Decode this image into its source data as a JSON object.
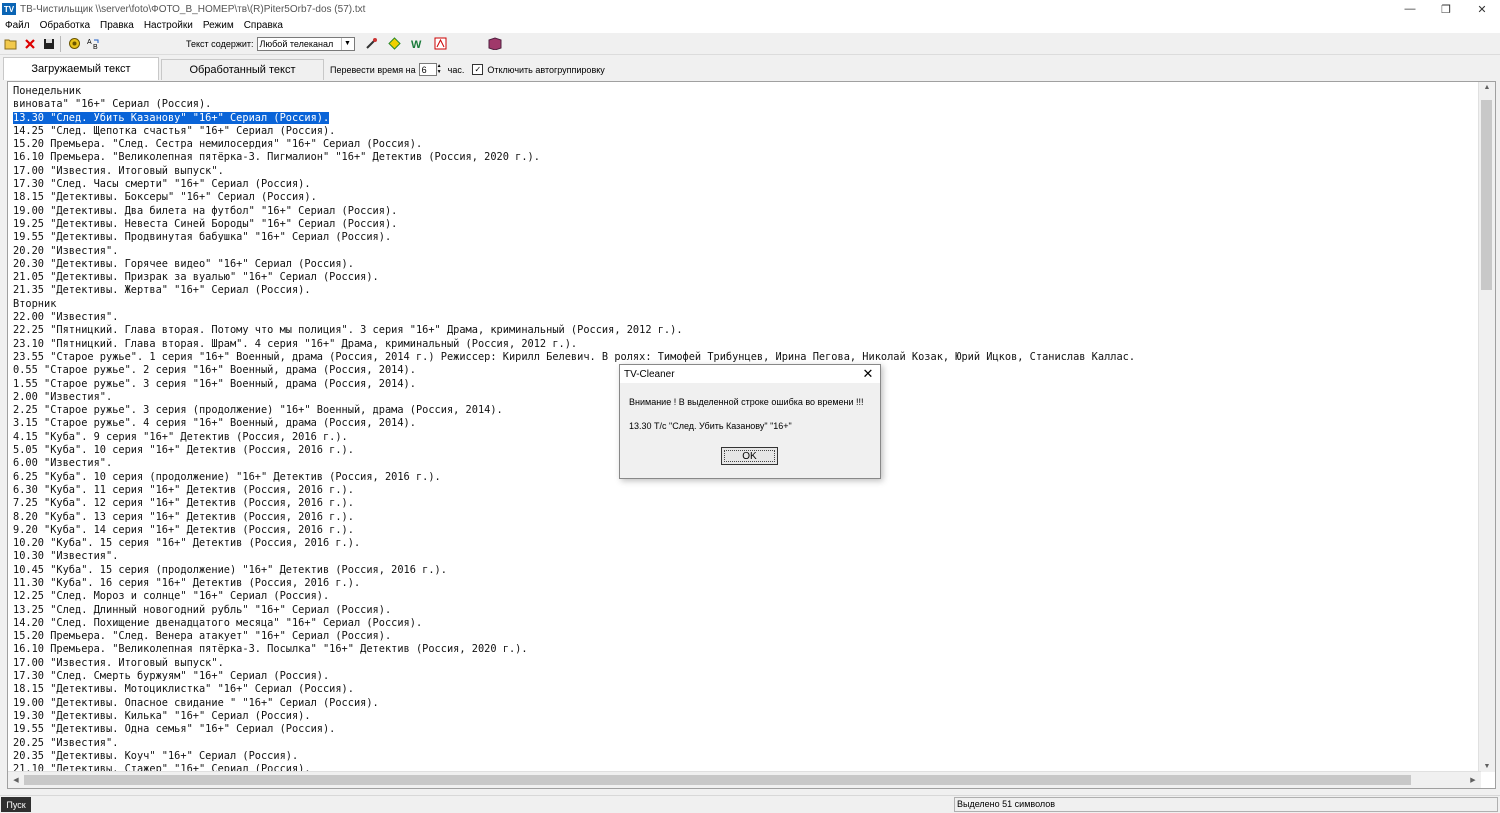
{
  "window": {
    "app_icon": "TV",
    "title": "ТВ-Чистильщик    \\\\server\\foto\\ФОТО_В_НОМЕР\\тв\\(R)Piter5Orb7-dos (57).txt",
    "minimize_glyph": "—",
    "maximize_glyph": "❐",
    "close_glyph": "✕"
  },
  "menu": [
    "Файл",
    "Обработка",
    "Правка",
    "Настройки",
    "Режим",
    "Справка"
  ],
  "toolbar": {
    "icons": [
      "folder-open-icon",
      "delete-icon",
      "save-icon",
      "process-icon",
      "replace-icon"
    ],
    "filter_label": "Текст содержит:",
    "filter_value": "Любой телеканал",
    "right_icons": [
      "tools-icon",
      "diamond-icon",
      "w-icon",
      "acrobat-icon",
      "book-icon"
    ]
  },
  "tabs": {
    "loaded": "Загружаемый текст",
    "processed": "Обработанный текст",
    "shift_label": "Перевести время на",
    "shift_value": "6",
    "shift_unit": "час.",
    "autogroup_label": "Отключить автогруппировку",
    "autogroup_checked": true
  },
  "text_lines": [
    "Понедельник",
    "виновата\" \"16+\" Сериал (Россия).",
    "13.30 \"След. Убить Казанову\" \"16+\" Сериал (Россия).",
    "14.25 \"След. Щепотка счастья\" \"16+\" Сериал (Россия).",
    "15.20 Премьера. \"След. Сестра немилосердия\" \"16+\" Сериал (Россия).",
    "16.10 Премьера. \"Великолепная пятёрка-3. Пигмалион\" \"16+\" Детектив (Россия, 2020 г.).",
    "17.00 \"Известия. Итоговый выпуск\".",
    "17.30 \"След. Часы смерти\" \"16+\" Сериал (Россия).",
    "18.15 \"Детективы. Боксеры\" \"16+\" Сериал (Россия).",
    "19.00 \"Детективы. Два билета на футбол\" \"16+\" Сериал (Россия).",
    "19.25 \"Детективы. Невеста Синей Бороды\" \"16+\" Сериал (Россия).",
    "19.55 \"Детективы. Продвинутая бабушка\" \"16+\" Сериал (Россия).",
    "20.20 \"Известия\".",
    "20.30 \"Детективы. Горячее видео\" \"16+\" Сериал (Россия).",
    "21.05 \"Детективы. Призрак за вуалью\" \"16+\" Сериал (Россия).",
    "21.35 \"Детективы. Жертва\" \"16+\" Сериал (Россия).",
    "Вторник",
    "22.00 \"Известия\".",
    "22.25 \"Пятницкий. Глава вторая. Потому что мы полиция\". 3 серия \"16+\" Драма, криминальный (Россия, 2012 г.).",
    "23.10 \"Пятницкий. Глава вторая. Шрам\". 4 серия \"16+\" Драма, криминальный (Россия, 2012 г.).",
    "23.55 \"Старое ружье\". 1 серия \"16+\" Военный, драма (Россия, 2014 г.) Режиссер: Кирилл Белевич. В ролях: Тимофей Трибунцев, Ирина Пегова, Николай Козак, Юрий Ицков, Станислав Каллас.",
    "0.55 \"Старое ружье\". 2 серия \"16+\" Военный, драма (Россия, 2014).",
    "1.55 \"Старое ружье\". 3 серия \"16+\" Военный, драма (Россия, 2014).",
    "2.00 \"Известия\".",
    "2.25 \"Старое ружье\". 3 серия (продолжение) \"16+\" Военный, драма (Россия, 2014).",
    "3.15 \"Старое ружье\". 4 серия \"16+\" Военный, драма (Россия, 2014).",
    "4.15 \"Куба\". 9 серия \"16+\" Детектив (Россия, 2016 г.).",
    "5.05 \"Куба\". 10 серия \"16+\" Детектив (Россия, 2016 г.).",
    "6.00 \"Известия\".",
    "6.25 \"Куба\". 10 серия (продолжение) \"16+\" Детектив (Россия, 2016 г.).",
    "6.30 \"Куба\". 11 серия \"16+\" Детектив (Россия, 2016 г.).",
    "7.25 \"Куба\". 12 серия \"16+\" Детектив (Россия, 2016 г.).",
    "8.20 \"Куба\". 13 серия \"16+\" Детектив (Россия, 2016 г.).",
    "9.20 \"Куба\". 14 серия \"16+\" Детектив (Россия, 2016 г.).",
    "10.20 \"Куба\". 15 серия \"16+\" Детектив (Россия, 2016 г.).",
    "10.30 \"Известия\".",
    "10.45 \"Куба\". 15 серия (продолжение) \"16+\" Детектив (Россия, 2016 г.).",
    "11.30 \"Куба\". 16 серия \"16+\" Детектив (Россия, 2016 г.).",
    "12.25 \"След. Мороз и солнце\" \"16+\" Сериал (Россия).",
    "13.25 \"След. Длинный новогодний рубль\" \"16+\" Сериал (Россия).",
    "14.20 \"След. Похищение двенадцатого месяца\" \"16+\" Сериал (Россия).",
    "15.20 Премьера. \"След. Венера атакует\" \"16+\" Сериал (Россия).",
    "16.10 Премьера. \"Великолепная пятёрка-3. Посылка\" \"16+\" Детектив (Россия, 2020 г.).",
    "17.00 \"Известия. Итоговый выпуск\".",
    "17.30 \"След. Смерть буржуям\" \"16+\" Сериал (Россия).",
    "18.15 \"Детективы. Мотоциклистка\" \"16+\" Сериал (Россия).",
    "19.00 \"Детективы. Опасное свидание \" \"16+\" Сериал (Россия).",
    "19.30 \"Детективы. Килька\" \"16+\" Сериал (Россия).",
    "19.55 \"Детективы. Одна семья\" \"16+\" Сериал (Россия).",
    "20.25 \"Известия\".",
    "20.35 \"Детективы. Коуч\" \"16+\" Сериал (Россия).",
    "21.10 \"Детективы. Стажер\" \"16+\" Сериал (Россия)."
  ],
  "selected_line_index": 2,
  "dialog": {
    "title": "TV-Cleaner",
    "message": "Внимание ! В выделенной строке ошибка во времени !!!",
    "detail": "13.30 Т/с \"След. Убить Казанову\" \"16+\"",
    "ok_label": "OK",
    "close_glyph": "✕"
  },
  "status": {
    "start_label": "Пуск",
    "selection_info": "Выделено 51 символов"
  },
  "colors": {
    "selection": "#0a64d8",
    "window_bg": "#f0f0f0",
    "text_bg": "#ffffff"
  }
}
